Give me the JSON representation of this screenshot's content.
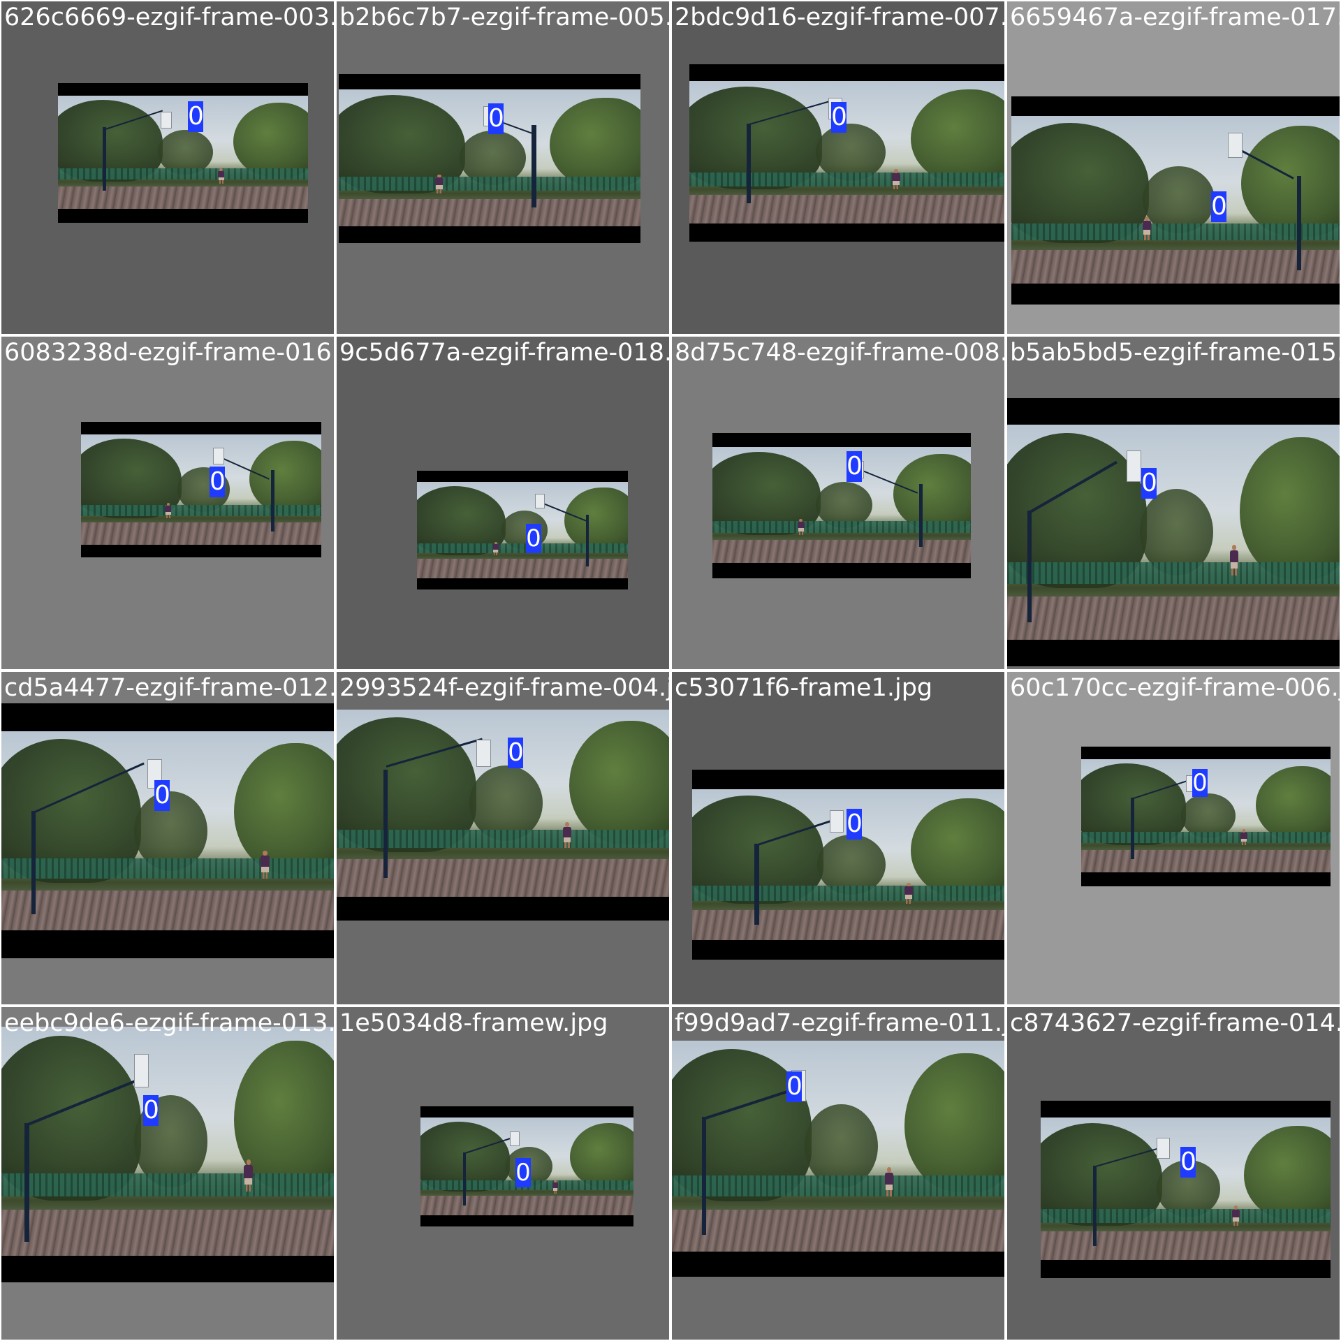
{
  "colors": {
    "page_background": "#ffffff",
    "label_text": "#ffffff",
    "letterbox": "#000000",
    "detection_label_bg": "#1f3bff",
    "detection_label_text": "#ffffff"
  },
  "tiles": [
    {
      "filename": "626c6669-ezgif-frame-003.jpg",
      "tile_bg": "#5e5e5e",
      "detection_class": "0"
    },
    {
      "filename": "b2b6c7b7-ezgif-frame-005.jpg",
      "tile_bg": "#6c6c6c",
      "detection_class": "0"
    },
    {
      "filename": "2bdc9d16-ezgif-frame-007.jpg",
      "tile_bg": "#5a5a5a",
      "detection_class": "0"
    },
    {
      "filename": "6659467a-ezgif-frame-017.jpg",
      "tile_bg": "#9a9a9a",
      "detection_class": "0"
    },
    {
      "filename": "6083238d-ezgif-frame-016.jpg",
      "tile_bg": "#7d7d7d",
      "detection_class": "0"
    },
    {
      "filename": "9c5d677a-ezgif-frame-018.jpg",
      "tile_bg": "#5e5e5e",
      "detection_class": "0"
    },
    {
      "filename": "8d75c748-ezgif-frame-008.jpg",
      "tile_bg": "#7c7c7c",
      "detection_class": "0"
    },
    {
      "filename": "b5ab5bd5-ezgif-frame-015.jpg",
      "tile_bg": "#6f6f6f",
      "detection_class": "0"
    },
    {
      "filename": "cd5a4477-ezgif-frame-012.jpg",
      "tile_bg": "#7a7a7a",
      "detection_class": "0"
    },
    {
      "filename": "2993524f-ezgif-frame-004.jpg",
      "tile_bg": "#6a6a6a",
      "detection_class": "0"
    },
    {
      "filename": "c53071f6-frame1.jpg",
      "tile_bg": "#5c5c5c",
      "detection_class": "0"
    },
    {
      "filename": "60c170cc-ezgif-frame-006.jpg",
      "tile_bg": "#9a9a9a",
      "detection_class": "0"
    },
    {
      "filename": "eebc9de6-ezgif-frame-013.jpg",
      "tile_bg": "#7c7c7c",
      "detection_class": "0"
    },
    {
      "filename": "1e5034d8-framew.jpg",
      "tile_bg": "#6a6a6a",
      "detection_class": "0"
    },
    {
      "filename": "f99d9ad7-ezgif-frame-011.jpg",
      "tile_bg": "#6c6c6c",
      "detection_class": "0"
    },
    {
      "filename": "c8743627-ezgif-frame-014.jpg",
      "tile_bg": "#626262",
      "detection_class": "0"
    }
  ]
}
